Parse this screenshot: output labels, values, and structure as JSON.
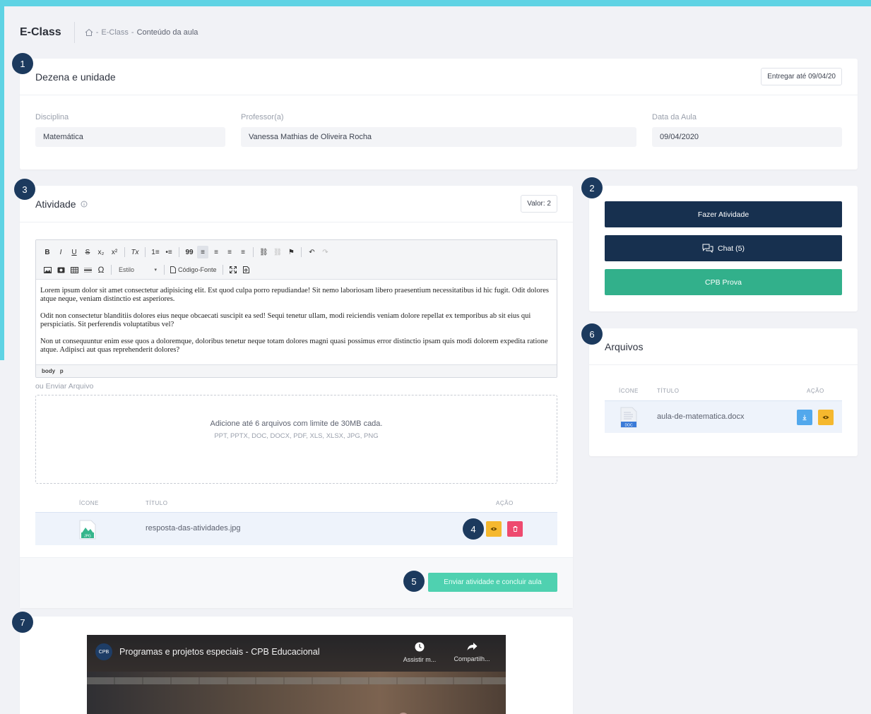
{
  "app": {
    "title": "E-Class"
  },
  "breadcrumb": {
    "items": [
      "E-Class",
      "Conteúdo da aula"
    ],
    "separator": "-"
  },
  "lesson": {
    "title": "Dezena e unidade",
    "deadline_label": "Entregar até 09/04/20",
    "fields": {
      "disciplina": {
        "label": "Disciplina",
        "value": "Matemática"
      },
      "professor": {
        "label": "Professor(a)",
        "value": "Vanessa Mathias de Oliveira Rocha"
      },
      "data": {
        "label": "Data da Aula",
        "value": "09/04/2020"
      }
    }
  },
  "activity": {
    "title": "Atividade",
    "value_label": "Valor: 2",
    "toolbar": {
      "row1": [
        "B",
        "I",
        "U",
        "S",
        "x₂",
        "x²",
        "Tx",
        "1≡",
        "•≡",
        "99",
        "≡",
        "≡",
        "≡",
        "≡",
        "⛓",
        "⛓",
        "⚑",
        "↶",
        "↷"
      ],
      "style_label": "Estilo",
      "source_label": "Código-Fonte"
    },
    "editor_paragraphs": [
      "Lorem ipsum dolor sit amet consectetur adipisicing elit. Est quod culpa porro repudiandae! Sit nemo laboriosam libero praesentium necessitatibus id hic fugit. Odit dolores atque neque, veniam distinctio est asperiores.",
      "Odit non consectetur blanditiis dolores eius neque obcaecati suscipit ea sed! Sequi tenetur ullam, modi reiciendis veniam dolore repellat ex temporibus ab sit eius qui perspiciatis. Sit perferendis voluptatibus vel?",
      "Non ut consequuntur enim esse quos a doloremque, doloribus tenetur neque totam dolores magni quasi possimus error distinctio ipsam quis modi dolorem expedita ratione atque. Adipisci aut quas reprehenderit dolores?"
    ],
    "editor_path": "body   p",
    "upload_label": "ou Enviar Arquivo",
    "dropzone": {
      "main": "Adicione até 6 arquivos com limite de 30MB cada.",
      "formats": "PPT, PPTX, DOC, DOCX, PDF, XLS, XLSX, JPG, PNG"
    },
    "table": {
      "headers": {
        "icon": "ÍCONE",
        "title": "TÍTULO",
        "action": "AÇÃO"
      },
      "rows": [
        {
          "icon_badge": "JPG",
          "title": "resposta-das-atividades.jpg"
        }
      ]
    },
    "submit_label": "Enviar atividade e concluir aula"
  },
  "actions": {
    "do_activity": "Fazer Atividade",
    "chat": "Chat (5)",
    "exam": "CPB Prova"
  },
  "files": {
    "title": "Arquivos",
    "headers": {
      "icon": "ÍCONE",
      "title": "TÍTULO",
      "action": "AÇÃO"
    },
    "rows": [
      {
        "icon_badge": "DOC",
        "title": "aula-de-matematica.docx"
      }
    ]
  },
  "video": {
    "title": "Programas e projetos especiais - CPB Educacional",
    "logo_text": "CPB",
    "watch_later": "Assistir m...",
    "share": "Compartilh..."
  },
  "badges": [
    "1",
    "2",
    "3",
    "4",
    "5",
    "6",
    "7"
  ],
  "colors": {
    "frame": "#5fd3e4",
    "badge": "#1c3a5e",
    "dark_button": "#17304f",
    "green_button": "#32b08b",
    "submit_button": "#4fd1b0",
    "view_button": "#f5b82e",
    "delete_button": "#ee4a6f",
    "download_button": "#52a8ec"
  }
}
